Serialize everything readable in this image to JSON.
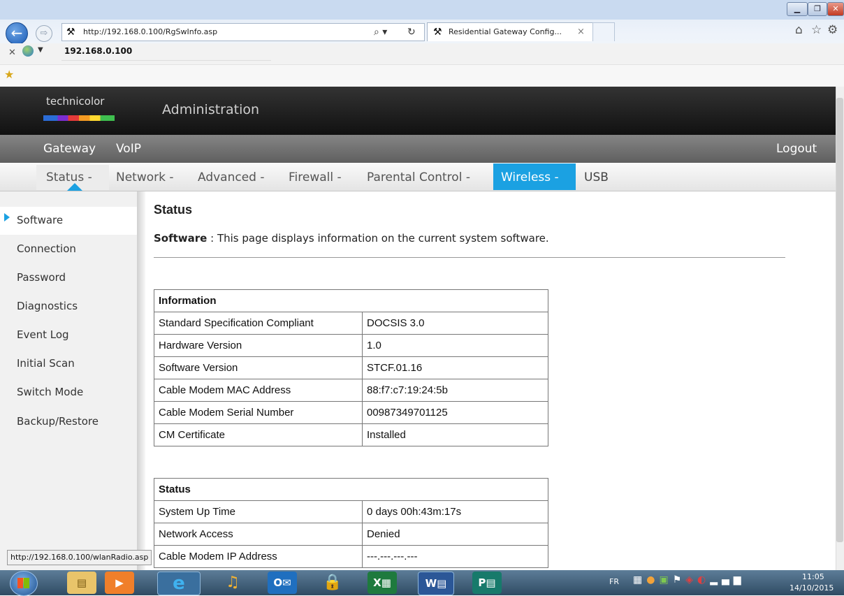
{
  "browser": {
    "address_url": "http://192.168.0.100/RgSwInfo.asp",
    "tab_title": "Residential Gateway Config...",
    "tab_close": "×",
    "toolbar_host": "192.168.0.100",
    "status_url": "http://192.168.0.100/wlanRadio.asp",
    "search_glyph": "⌕ ▾",
    "refresh_glyph": "↻"
  },
  "header": {
    "brand": "technicolor",
    "title": "Administration"
  },
  "nav_primary": {
    "items": [
      "Gateway",
      "VoIP"
    ],
    "logout": "Logout"
  },
  "nav_secondary": {
    "items": [
      "Status -",
      "Network -",
      "Advanced -",
      "Firewall -",
      "Parental Control -",
      "Wireless -",
      "USB"
    ],
    "active_index": 0,
    "highlight_index": 5
  },
  "sidebar": {
    "items": [
      "Software",
      "Connection",
      "Password",
      "Diagnostics",
      "Event Log",
      "Initial Scan",
      "Switch Mode",
      "Backup/Restore"
    ],
    "active_index": 0
  },
  "main": {
    "heading": "Status",
    "intro_bold": "Software",
    "intro_text": " :  This page displays information on the current system software.",
    "info_table": {
      "title": "Information",
      "rows": [
        {
          "key": "Standard Specification Compliant",
          "value": "DOCSIS 3.0"
        },
        {
          "key": "Hardware Version",
          "value": "1.0"
        },
        {
          "key": "Software Version",
          "value": "STCF.01.16"
        },
        {
          "key": "Cable Modem MAC Address",
          "value": "88:f7:c7:19:24:5b"
        },
        {
          "key": "Cable Modem Serial Number",
          "value": "00987349701125"
        },
        {
          "key": "CM Certificate",
          "value": "Installed"
        }
      ]
    },
    "status_table": {
      "title": "Status",
      "rows": [
        {
          "key": "System Up Time",
          "value": "0 days 00h:43m:17s"
        },
        {
          "key": "Network Access",
          "value": "Denied"
        },
        {
          "key": "Cable Modem IP Address",
          "value": "---.---.---.---"
        }
      ]
    }
  },
  "taskbar": {
    "lang": "FR",
    "time": "11:05",
    "date": "14/10/2015",
    "apps": [
      "windows-start",
      "file-explorer",
      "media-player",
      "internet-explorer",
      "headphones-app",
      "outlook",
      "lock-app",
      "excel",
      "word",
      "publisher"
    ]
  },
  "colors": {
    "header_bg": "#1a1a1a",
    "nav_bg": "#6e6e6e",
    "highlight": "#1ba1e2",
    "sidebar_bg": "#f1f1f1"
  }
}
